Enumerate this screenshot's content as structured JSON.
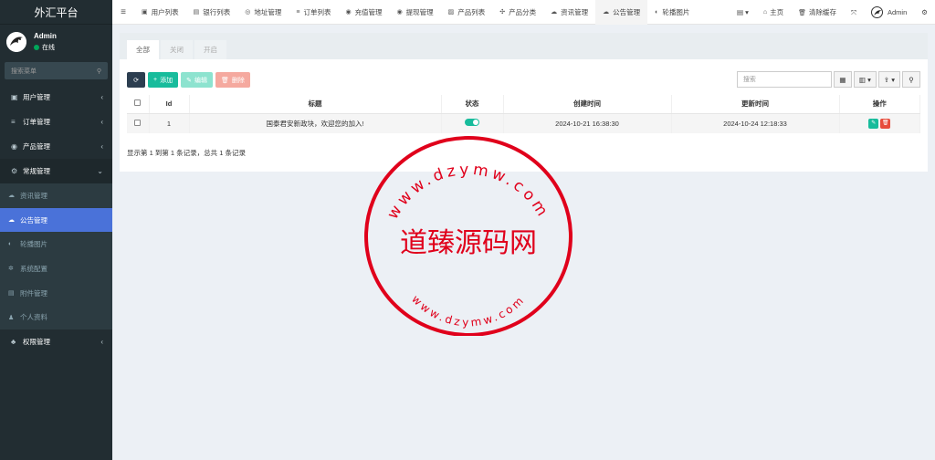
{
  "brand": "外汇平台",
  "user": {
    "name": "Admin",
    "status": "在线"
  },
  "sidebar": {
    "search_placeholder": "搜索菜单",
    "items": [
      {
        "label": "用户管理",
        "icon": "user-icon",
        "glyph": "▣",
        "arrow": "‹"
      },
      {
        "label": "订单管理",
        "icon": "list-icon",
        "glyph": "≡",
        "arrow": "‹"
      },
      {
        "label": "产品管理",
        "icon": "product-icon",
        "glyph": "◉",
        "arrow": "‹"
      },
      {
        "label": "常规管理",
        "icon": "cogs-icon",
        "glyph": "⚙",
        "arrow": "⌄"
      }
    ],
    "subitems": [
      {
        "label": "资讯管理",
        "icon": "cloud-icon",
        "glyph": "☁"
      },
      {
        "label": "公告管理",
        "icon": "cloud-upload-icon",
        "glyph": "☁"
      },
      {
        "label": "轮播图片",
        "icon": "image-icon",
        "glyph": "◐"
      },
      {
        "label": "系统配置",
        "icon": "gear-icon",
        "glyph": "✲"
      },
      {
        "label": "附件管理",
        "icon": "file-icon",
        "glyph": "▤"
      },
      {
        "label": "个人资料",
        "icon": "person-icon",
        "glyph": "♟"
      }
    ],
    "last_item": {
      "label": "权限管理",
      "icon": "group-icon",
      "glyph": "♣",
      "arrow": "‹"
    }
  },
  "topnav": {
    "tabs": [
      {
        "label": "用户列表",
        "glyph": "▣"
      },
      {
        "label": "银行列表",
        "glyph": "▤"
      },
      {
        "label": "地址管理",
        "glyph": "◎"
      },
      {
        "label": "订单列表",
        "glyph": "≡"
      },
      {
        "label": "充值管理",
        "glyph": "◉"
      },
      {
        "label": "提现管理",
        "glyph": "◉"
      },
      {
        "label": "产品列表",
        "glyph": "▨"
      },
      {
        "label": "产品分类",
        "glyph": "✣"
      },
      {
        "label": "资讯管理",
        "glyph": "☁"
      },
      {
        "label": "公告管理",
        "glyph": "☁"
      },
      {
        "label": "轮播图片",
        "glyph": "◐"
      }
    ],
    "right": {
      "menu_glyph": "▤ ▾",
      "home": "主页",
      "clear_cache": "清除缓存",
      "fullscreen_glyph": "⤧",
      "admin": "Admin",
      "settings_glyph": "⚙"
    }
  },
  "panel": {
    "tabs": [
      "全部",
      "关闭",
      "开启"
    ],
    "toolbar": {
      "add": "添加",
      "edit": "编辑",
      "delete": "删除"
    },
    "search_placeholder": "搜索",
    "table": {
      "headers": [
        "",
        "Id",
        "标题",
        "状态",
        "创建时间",
        "更新时间",
        "操作"
      ],
      "rows": [
        {
          "id": "1",
          "title": "国泰君安新政块，欢迎您的加入!",
          "status": "on",
          "created": "2024-10-21 16:38:30",
          "updated": "2024-10-24 12:18:33"
        }
      ]
    },
    "pagination": "显示第 1 到第 1 条记录，总共 1 条记录"
  },
  "watermark": {
    "center_text": "道臻源码网",
    "top_arc": "www.dzymw.com",
    "bottom_arc": "www.dzymw.com",
    "color": "#e0001b"
  }
}
